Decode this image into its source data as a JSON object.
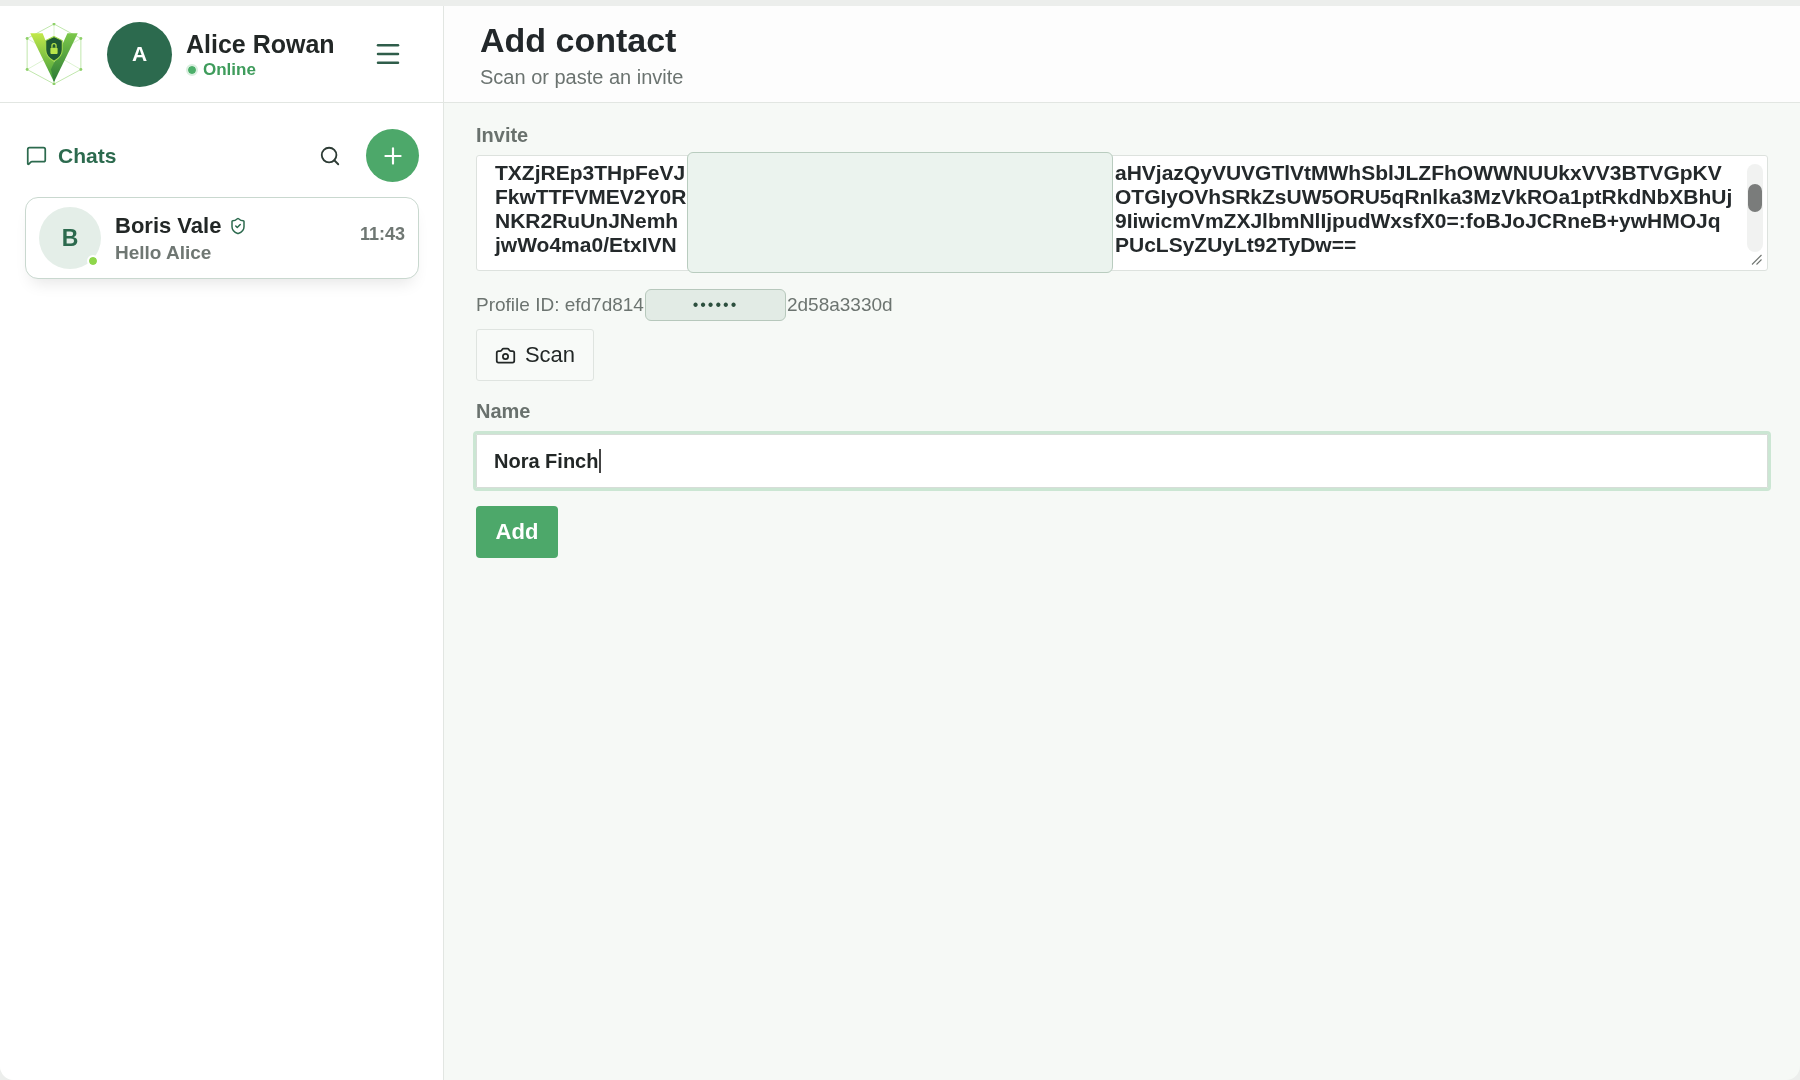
{
  "user": {
    "initial": "A",
    "name": "Alice Rowan",
    "status": "Online",
    "online": true
  },
  "sidebar": {
    "title": "Chats",
    "chats": [
      {
        "initial": "B",
        "name": "Boris Vale",
        "verified": true,
        "online": true,
        "preview": "Hello Alice",
        "time": "11:43",
        "selected": true
      }
    ]
  },
  "page": {
    "title": "Add contact",
    "subtitle": "Scan or paste an invite"
  },
  "form": {
    "invite": {
      "label": "Invite",
      "redacted": true,
      "lines": [
        {
          "left": "TXZjREp3THpFeVJ",
          "right": "aHVjazQyVUVGTlVtMWhSblJLZFhOWWNUUkxVV3BTVGpKV"
        },
        {
          "left": "FkwTTFVMEV2Y0R",
          "right": "OTGIyOVhSRkZsUW5ORU5qRnlka3MzVkROa1ptRkdNbXBhUj"
        },
        {
          "left": "NKR2RuUnJNemh",
          "right": "9IiwicmVmZXJlbmNlIjpudWxsfX0=:foBJoJCRneB+ywHMOJq"
        },
        {
          "left": "jwWo4ma0/EtxIVN",
          "right": "PUcLSyZUyLt92TyDw=="
        }
      ]
    },
    "profile_id": {
      "prefix": "Profile ID: efd7d814",
      "masked": "••••••",
      "suffix": "2d58a3330d"
    },
    "scan_button": "Scan",
    "name": {
      "label": "Name",
      "value": "Nora Finch",
      "focused": true
    },
    "submit_button": "Add"
  }
}
